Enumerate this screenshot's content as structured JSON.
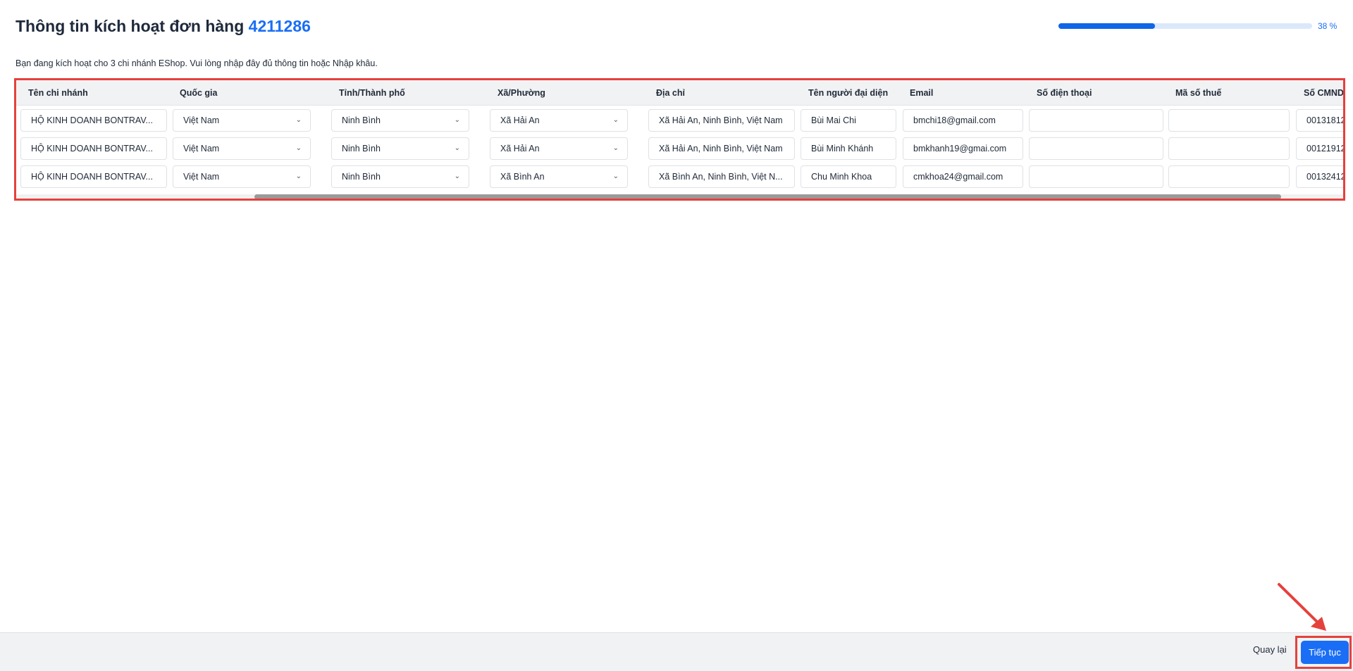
{
  "header": {
    "title": "Thông tin kích hoạt đơn hàng",
    "order_number": "4211286",
    "progress_percent": 38,
    "progress_label": "38 %"
  },
  "subtitle": "Bạn đang kích hoạt cho 3 chi nhánh EShop. Vui lòng nhập đây đủ thông tin hoặc Nhập khâu.",
  "table": {
    "columns": [
      "Tên chi nhánh",
      "Quốc gia",
      "Tỉnh/Thành phố",
      "Xã/Phường",
      "Địa chỉ",
      "Tên người đại diện",
      "Email",
      "Số điện thoại",
      "Mã số thuế",
      "Số CMND"
    ],
    "rows": [
      [
        "HỘ KINH DOANH BONTRAV...",
        "Việt Nam",
        "Ninh Bình",
        "Xã Hải An",
        "Xã Hải An, Ninh Bình, Việt Nam",
        "Bùi Mai Chi",
        "bmchi18@gmail.com",
        "",
        "",
        "00131812"
      ],
      [
        "HỘ KINH DOANH BONTRAV...",
        "Việt Nam",
        "Ninh Bình",
        "Xã Hải An",
        "Xã Hải An, Ninh Bình, Việt Nam",
        "Bùi Minh Khánh",
        "bmkhanh19@gmai.com",
        "",
        "",
        "00121912"
      ],
      [
        "HỘ KINH DOANH BONTRAV...",
        "Việt Nam",
        "Ninh Bình",
        "Xã Bình An",
        "Xã Bình An, Ninh Bình, Việt N...",
        "Chu Minh Khoa",
        "cmkhoa24@gmail.com",
        "",
        "",
        "00132412"
      ]
    ]
  },
  "footer": {
    "back_label": "Quay lại",
    "next_label": "Tiếp tục"
  },
  "colors": {
    "accent": "#1a6ef5",
    "highlight": "#e5413c"
  }
}
